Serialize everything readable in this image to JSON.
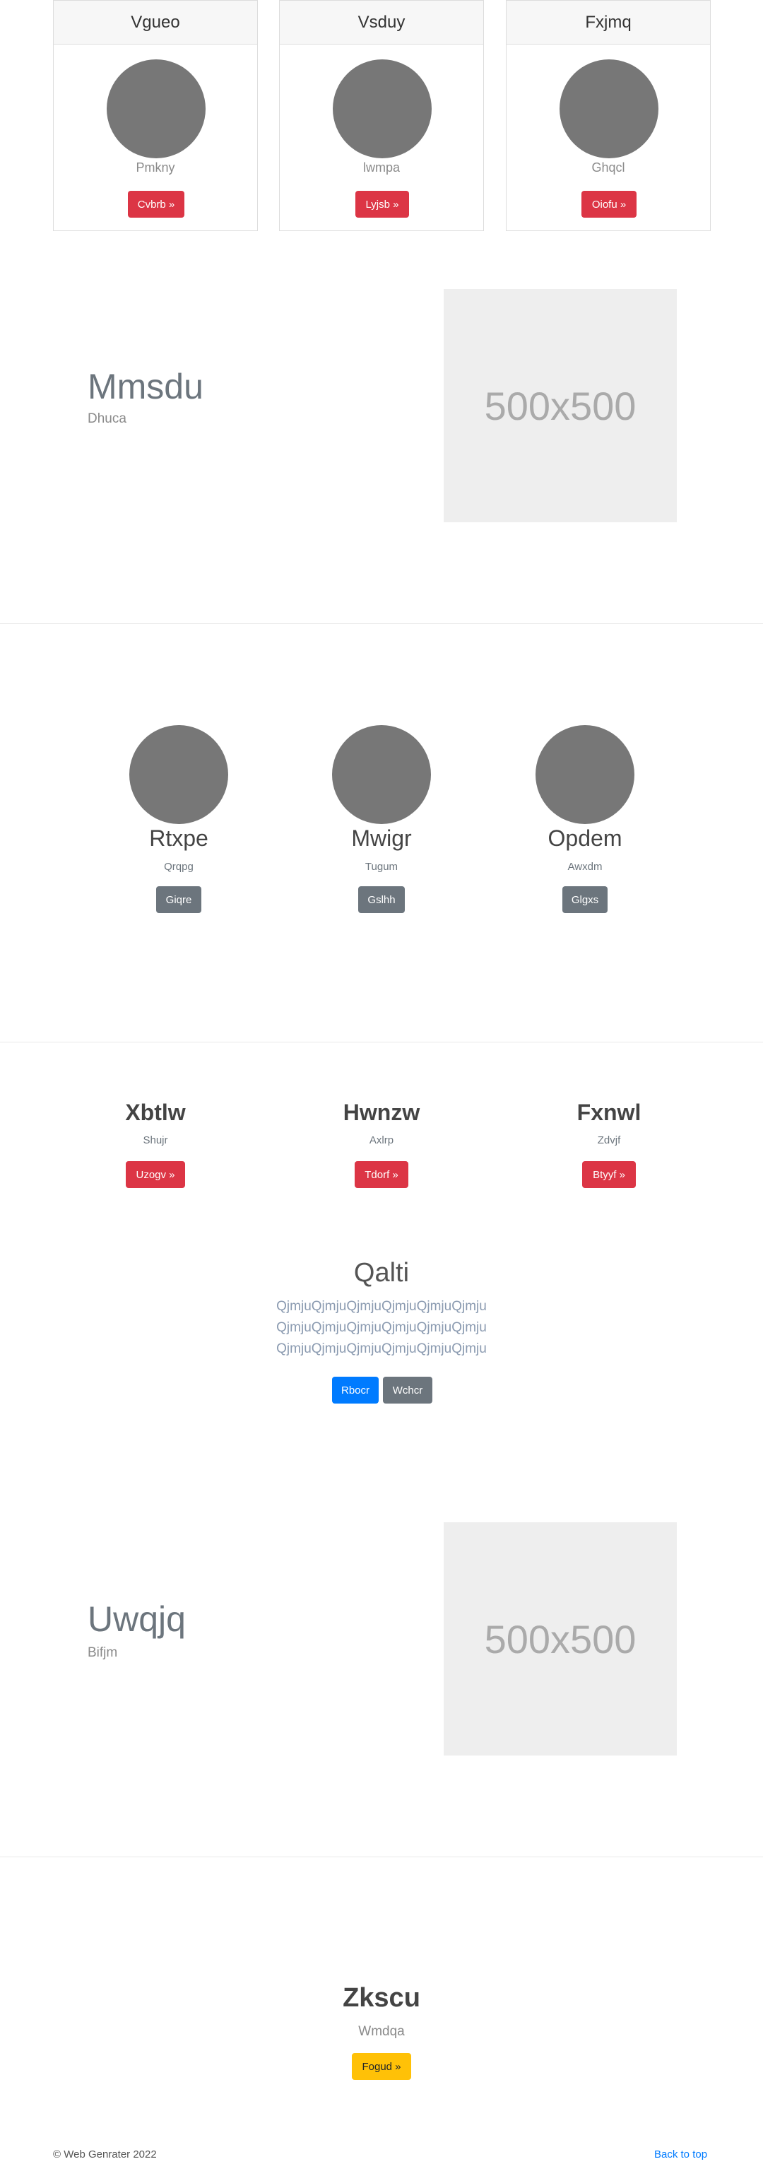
{
  "cards": [
    {
      "title": "Vgueo",
      "subtitle": "Pmkny",
      "button": "Cvbrb »"
    },
    {
      "title": "Vsduy",
      "subtitle": "lwmpa",
      "button": "Lyjsb »"
    },
    {
      "title": "Fxjmq",
      "subtitle": "Ghqcl",
      "button": "Oiofu »"
    }
  ],
  "feature1": {
    "title": "Mmsdu",
    "subtitle": "Dhuca",
    "image_label": "500x500"
  },
  "people": [
    {
      "name": "Rtxpe",
      "subtitle": "Qrqpg",
      "button": "Giqre"
    },
    {
      "name": "Mwigr",
      "subtitle": "Tugum",
      "button": "Gslhh"
    },
    {
      "name": "Opdem",
      "subtitle": "Awxdm",
      "button": "Glgxs"
    }
  ],
  "columns": [
    {
      "title": "Xbtlw",
      "subtitle": "Shujr",
      "button": "Uzogv »"
    },
    {
      "title": "Hwnzw",
      "subtitle": "Axlrp",
      "button": "Tdorf »"
    },
    {
      "title": "Fxnwl",
      "subtitle": "Zdvjf",
      "button": "Btyyf »"
    }
  ],
  "jumbotron": {
    "title": "Qalti",
    "lines": [
      "QjmjuQjmjuQjmjuQjmjuQjmjuQjmju",
      "QjmjuQjmjuQjmjuQjmjuQjmjuQjmju",
      "QjmjuQjmjuQjmjuQjmjuQjmjuQjmju"
    ],
    "primary_button": "Rbocr",
    "secondary_button": "Wchcr"
  },
  "feature2": {
    "title": "Uwqjq",
    "subtitle": "Bifjm",
    "image_label": "500x500"
  },
  "final": {
    "title": "Zkscu",
    "subtitle": "Wmdqa",
    "button": "Fogud »"
  },
  "footer": {
    "copyright": "© Web Genrater 2022",
    "back_to_top": "Back to top"
  },
  "colors": {
    "red": "#dc3545",
    "gray": "#6c757d",
    "blue": "#007bff",
    "yellow": "#ffc107",
    "avatar": "#777777",
    "placeholder": "#eeeeee"
  }
}
